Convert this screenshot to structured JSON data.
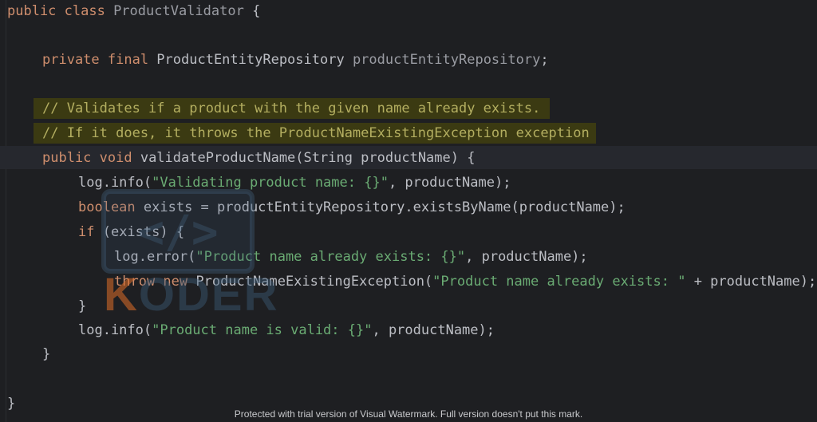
{
  "editor": {
    "lines": {
      "l1": {
        "kw": "public class ",
        "name": "ProductValidator",
        "rest": " {"
      },
      "l2": {
        "kw": "private final ",
        "type": "ProductEntityRepository ",
        "field": "productEntityRepository",
        "rest": ";"
      },
      "l3": {
        "comment": "// Validates if a product with the given name already exists."
      },
      "l4": {
        "comment": "// If it does, it throws the ProductNameExistingException exception"
      },
      "l5": {
        "kw": "public void ",
        "rest": "validateProductName(String productName) {"
      },
      "l6": {
        "pre": "log.info(",
        "str": "\"Validating product name: {}\"",
        "post": ", productName);"
      },
      "l7": {
        "kw": "boolean ",
        "rest": "exists = productEntityRepository.existsByName(productName);"
      },
      "l8": {
        "kw": "if ",
        "rest": "(exists) {"
      },
      "l9": {
        "pre": "log.error(",
        "str": "\"Product name already exists: {}\"",
        "post": ", productName);"
      },
      "l10": {
        "kw": "throw new ",
        "pre": "ProductNameExistingException(",
        "str": "\"Product name already exists: \"",
        "post": " + productName);"
      },
      "l11": {
        "rest": "}"
      },
      "l12": {
        "pre": "log.info(",
        "str": "\"Product name is valid: {}\"",
        "post": ", productName);"
      },
      "l13": {
        "rest": "}"
      },
      "l14": {
        "rest": "}"
      }
    }
  },
  "watermark": {
    "logo_glyph": "</>",
    "brand_first": "K",
    "brand_rest": "ODER"
  },
  "footer": {
    "note": "Protected with trial version of Visual Watermark. Full version doesn't put this mark."
  }
}
